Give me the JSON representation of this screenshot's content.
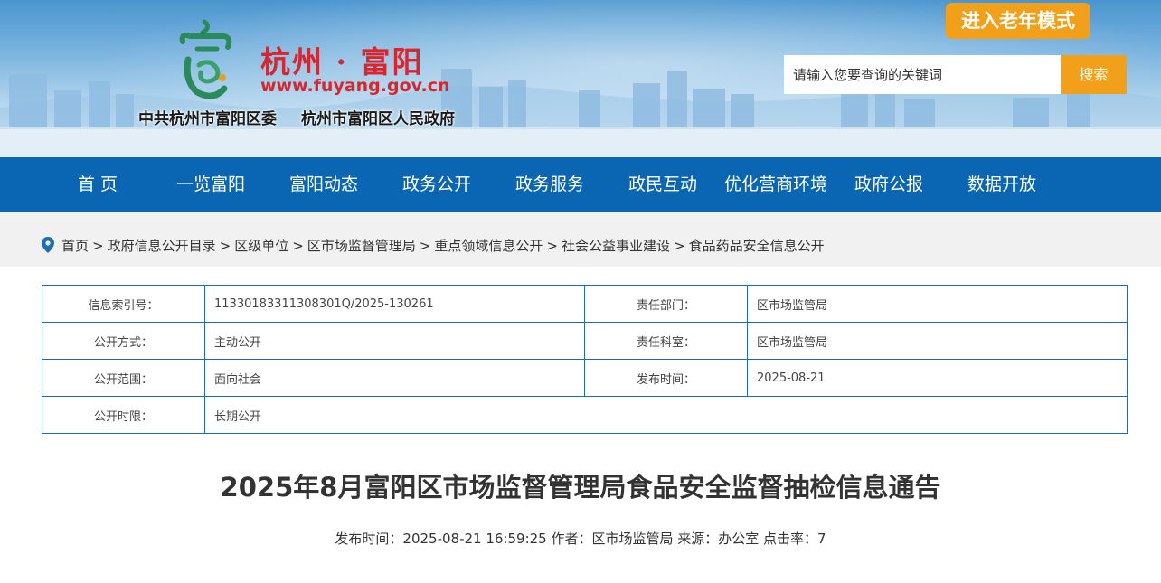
{
  "header": {
    "site_name": "杭州 · 富阳",
    "site_url": "www.fuyang.gov.cn",
    "org_party": "中共杭州市富阳区委",
    "org_gov": "杭州市富阳区人民政府",
    "emblem_icon": "fuyang-emblem-icon",
    "elder_mode_label": "进入老年模式",
    "search_placeholder": "请输入您要查询的关键词",
    "search_button": "搜索",
    "accent_color": "#f2a019",
    "brand_red": "#d7262d"
  },
  "nav": {
    "color": "#0a66b2",
    "items": [
      "首 页",
      "一览富阳",
      "富阳动态",
      "政务公开",
      "政务服务",
      "政民互动",
      "优化营商环境",
      "政府公报",
      "数据开放"
    ]
  },
  "breadcrumb": {
    "icon": "location-pin-icon",
    "items": [
      "首页",
      "政府信息公开目录",
      "区级单位",
      "区市场监督管理局",
      "重点领域信息公开",
      "社会公益事业建设",
      "食品药品安全信息公开"
    ],
    "separator": ">"
  },
  "info_table": {
    "index_no_label": "信息索引号：",
    "index_no": "11330183311308301Q/2025-130261",
    "dept_label": "责任部门：",
    "dept": "区市场监管局",
    "method_label": "公开方式：",
    "method": "主动公开",
    "office_label": "责任科室：",
    "office": "区市场监管局",
    "scope_label": "公开范围：",
    "scope": "面向社会",
    "date_label": "发布时间：",
    "date": "2025-08-21",
    "term_label": "公开时限：",
    "term": "长期公开"
  },
  "article": {
    "title": "2025年8月富阳区市场监督管理局食品安全监督抽检信息通告",
    "meta": "发布时间：2025-08-21  16:59:25 作者：区市场监管局 来源：办公室 点击率：7"
  }
}
